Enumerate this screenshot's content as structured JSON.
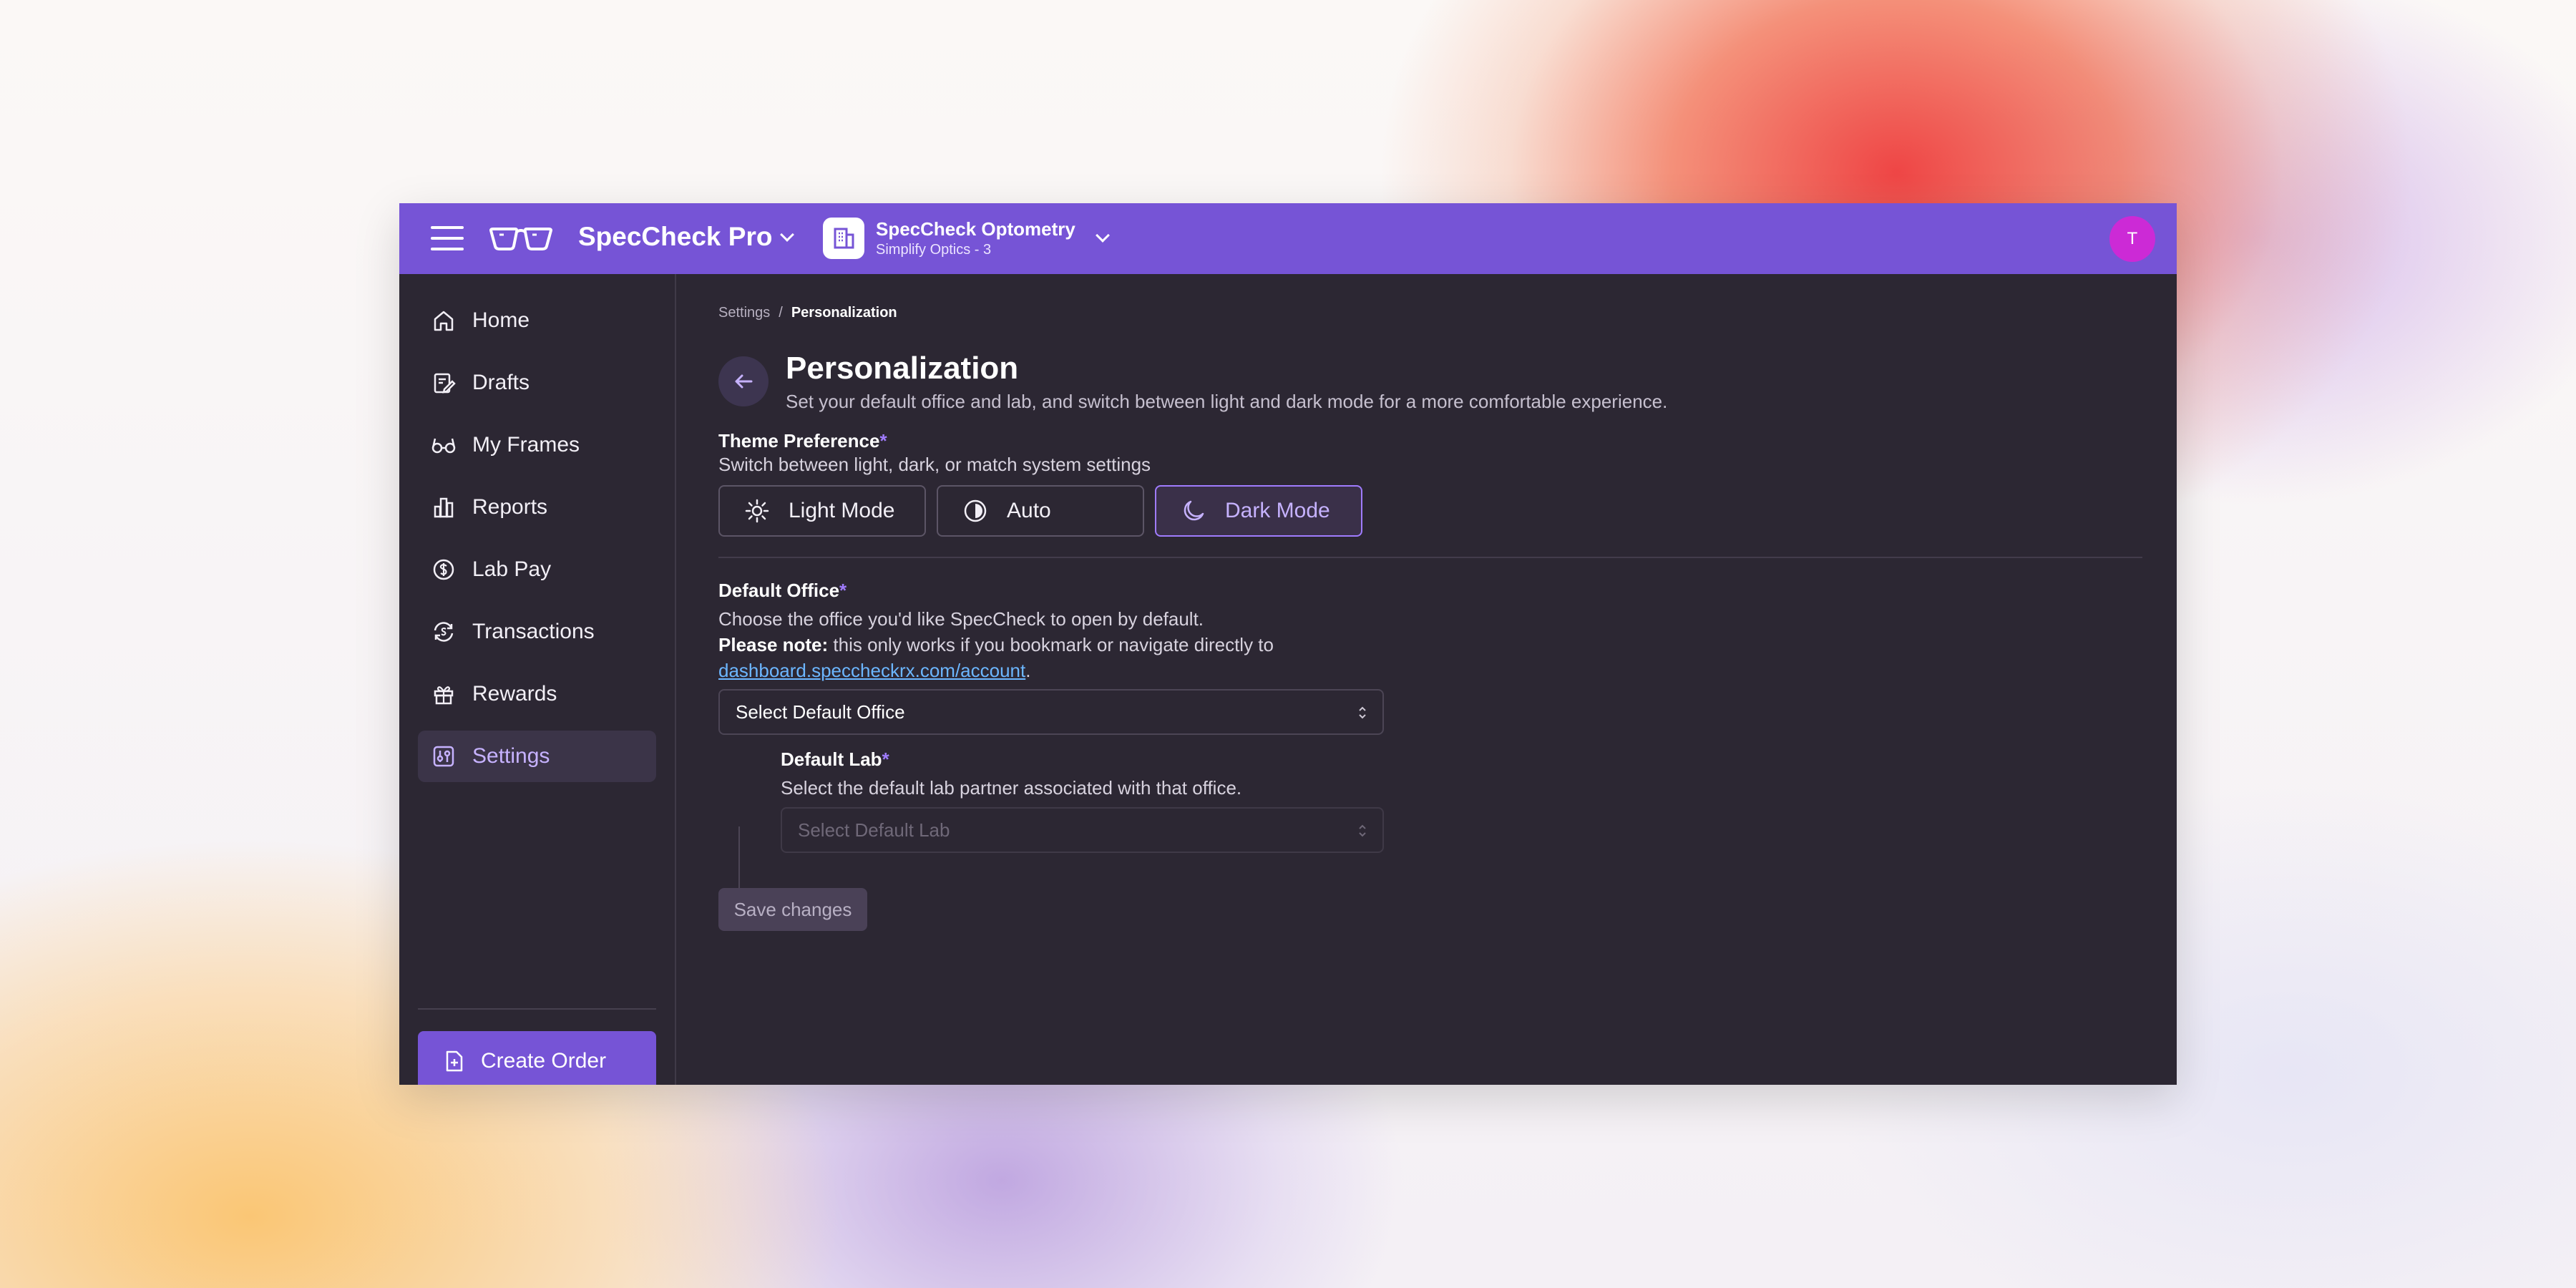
{
  "topbar": {
    "app_name": "SpecCheck Pro",
    "office_name": "SpecCheck Optometry",
    "office_sub": "Simplify Optics - 3",
    "avatar_initial": "T",
    "accent_color": "#7654d6",
    "avatar_color": "#cc2ad6"
  },
  "sidebar": {
    "items": [
      {
        "label": "Home",
        "icon": "home-icon"
      },
      {
        "label": "Drafts",
        "icon": "drafts-icon"
      },
      {
        "label": "My Frames",
        "icon": "glasses-icon"
      },
      {
        "label": "Reports",
        "icon": "bar-chart-icon"
      },
      {
        "label": "Lab Pay",
        "icon": "dollar-icon"
      },
      {
        "label": "Transactions",
        "icon": "transactions-icon"
      },
      {
        "label": "Rewards",
        "icon": "gift-icon"
      },
      {
        "label": "Settings",
        "icon": "settings-icon",
        "active": true
      }
    ],
    "create_order_label": "Create Order"
  },
  "main": {
    "breadcrumb": {
      "parent": "Settings",
      "separator": "/",
      "current": "Personalization"
    },
    "title": "Personalization",
    "subtitle": "Set your default office and lab, and switch between light and dark mode for a more comfortable experience.",
    "theme": {
      "label": "Theme Preference",
      "required_mark": "*",
      "description": "Switch between light, dark, or match system settings",
      "options": [
        {
          "label": "Light Mode",
          "icon": "sun-icon"
        },
        {
          "label": "Auto",
          "icon": "half-circle-icon"
        },
        {
          "label": "Dark Mode",
          "icon": "moon-icon",
          "selected": true
        }
      ]
    },
    "office": {
      "label": "Default Office",
      "required_mark": "*",
      "description": "Choose the office you'd like SpecCheck to open by default.",
      "note_bold": "Please note:",
      "note_text": " this only works if you bookmark or navigate directly to",
      "link": "dashboard.speccheckrx.com/account",
      "link_suffix": ".",
      "select_value": "Select Default Office"
    },
    "lab": {
      "label": "Default Lab",
      "required_mark": "*",
      "description": "Select the default lab partner associated with that office.",
      "select_placeholder": "Select Default Lab"
    },
    "save_label": "Save changes"
  }
}
